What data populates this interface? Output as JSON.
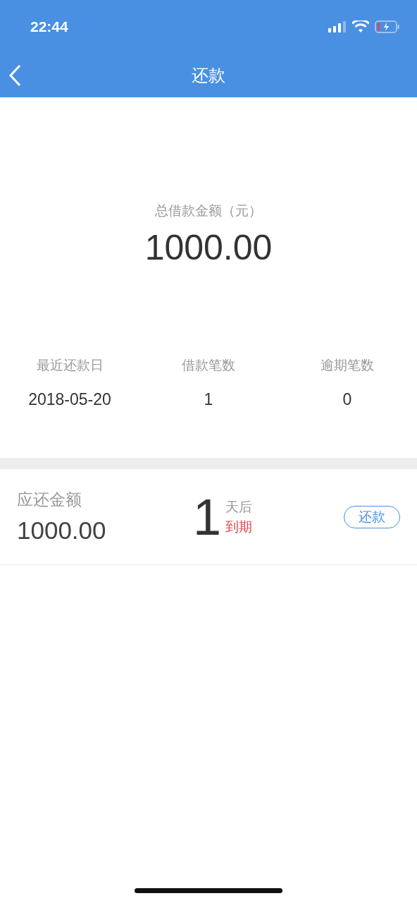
{
  "status_bar": {
    "time": "22:44"
  },
  "nav_bar": {
    "title": "还款"
  },
  "summary": {
    "label": "总借款金额（元）",
    "amount": "1000.00"
  },
  "stats": [
    {
      "label": "最近还款日",
      "value": "2018-05-20"
    },
    {
      "label": "借款笔数",
      "value": "1"
    },
    {
      "label": "逾期笔数",
      "value": "0"
    }
  ],
  "loans": [
    {
      "label": "应还金额",
      "amount": "1000.00",
      "days": "1",
      "days_unit": "天后",
      "due_text": "到期",
      "button": "还款"
    }
  ]
}
